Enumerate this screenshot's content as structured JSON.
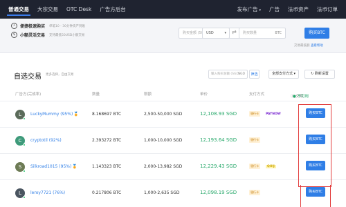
{
  "nav": {
    "left": [
      "普通交易",
      "大宗交易",
      "OTC Desk",
      "广告方后台"
    ],
    "right": [
      "发布广告",
      "广告",
      "法币资产",
      "法币订单"
    ],
    "caret": "▾"
  },
  "quick": {
    "row1_title": "便捷极速购买",
    "row1_hint": "单笔10 - 30分钟资产到账",
    "row2_title": "小额灵活交易",
    "row2_hint": "支持最低50USD小额交易",
    "amount_placeholder": "购买金额 (50 - 20,000)",
    "currency": "USD",
    "swap": "⇄",
    "qty_placeholder": "购买数量",
    "qty_unit": "BTC",
    "buy_label": "购买BTC",
    "more_text": "交易最低额 ",
    "more_link": "查看帮助"
  },
  "section": {
    "title": "自选交易",
    "subtitle": "更多选择，自由交易",
    "search_placeholder": "输入购买总额 (SGD)",
    "search_unit": "SGD",
    "search_btn": "筛选",
    "pay_btn": "全部支付方式 ▾",
    "refresh": "↻ 刷新设置"
  },
  "table": {
    "headers": [
      "广告方(完成率)",
      "数量",
      "限额",
      "单价",
      "支付方式"
    ],
    "toggle_label": "ⓘ 交易",
    "toggle_value": "● 不可用"
  },
  "rows": [
    {
      "initial": "L",
      "avatar_color": "#5b6b5a",
      "name": "LuckyMummy (95%)",
      "medal": "🏅",
      "qty": "8.168697 BTC",
      "limit": "2,500-50,000 SGD",
      "price": "12,108.93 SGD",
      "badge": "银行卡",
      "pay_logo": "PAYNOW",
      "pay_color": "#7b2ad1",
      "buy": "购买BTC"
    },
    {
      "initial": "C",
      "avatar_color": "#3e9a7a",
      "name": "cryptotil (92%)",
      "medal": "",
      "qty": "2.393272 BTC",
      "limit": "1,000-10,000 SGD",
      "price": "12,193.64 SGD",
      "badge": "银行卡",
      "pay_logo": "",
      "pay_color": "#333",
      "buy": "购买BTC"
    },
    {
      "initial": "S",
      "avatar_color": "#6d7b55",
      "name": "Silkroad1015 (95%)",
      "medal": "🏅",
      "qty": "1.143323 BTC",
      "limit": "2,000-13,982 SGD",
      "price": "12,229.43 SGD",
      "badge": "银行卡",
      "pay_logo": "QUIJ",
      "pay_color": "#c9a400",
      "buy": "购买BTC"
    },
    {
      "initial": "L",
      "avatar_color": "#4a5560",
      "name": "leroy7721 (76%)",
      "medal": "",
      "qty": "0.217806 BTC",
      "limit": "1,000-2,635 SGD",
      "price": "12,098.19 SGD",
      "badge": "银行卡",
      "pay_logo": "",
      "pay_color": "#333",
      "buy": "购买BTC"
    }
  ]
}
